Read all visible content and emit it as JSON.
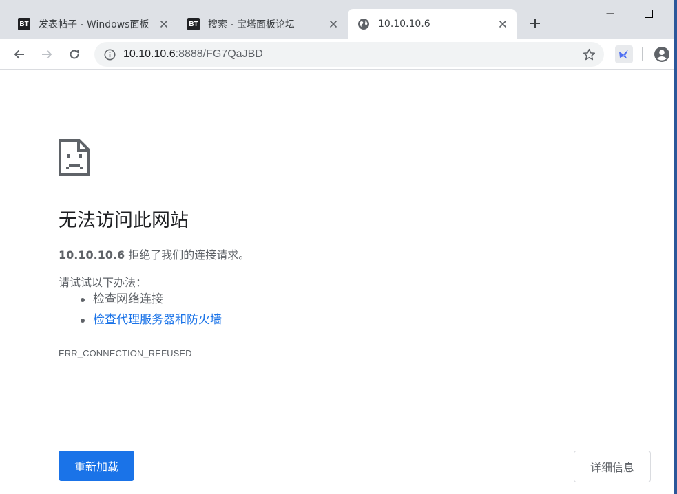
{
  "tabs": [
    {
      "favicon_text": "BT",
      "title": "发表帖子 - Windows面板",
      "active": false
    },
    {
      "favicon_text": "BT",
      "title": "搜索 - 宝塔面板论坛",
      "active": false
    },
    {
      "favicon_icon": "globe-icon",
      "title": "10.10.10.6",
      "active": true
    }
  ],
  "omnibox": {
    "url_host": "10.10.10.6",
    "url_rest": ":8888/FG7QaJBD"
  },
  "error_page": {
    "icon": "sad-page-icon",
    "heading": "无法访问此网站",
    "host": "10.10.10.6",
    "description": " 拒绝了我们的连接请求。",
    "try_label": "请试试以下办法：",
    "suggestions": [
      {
        "text": "检查网络连接",
        "is_link": false
      },
      {
        "text": "检查代理服务器和防火墙",
        "is_link": true
      }
    ],
    "error_code": "ERR_CONNECTION_REFUSED",
    "reload_label": "重新加载",
    "details_label": "详细信息"
  },
  "colors": {
    "accent": "#1a73e8",
    "tabstrip": "#dee1e6",
    "text_secondary": "#5f6368"
  }
}
